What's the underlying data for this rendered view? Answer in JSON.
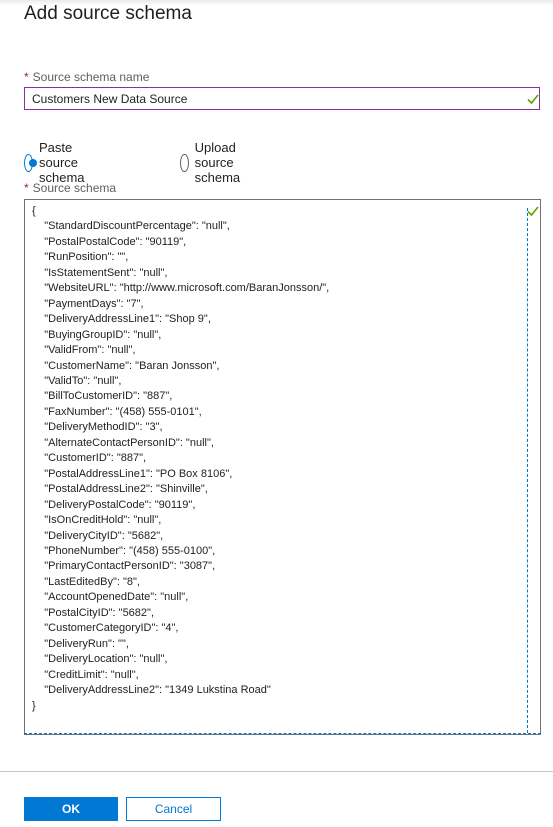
{
  "panel": {
    "title": "Add source schema"
  },
  "name_field": {
    "required_mark": "*",
    "label": "Source schema name",
    "value": "Customers New Data Source",
    "valid_icon": "checkmark-icon"
  },
  "schema_source": {
    "options": [
      {
        "label": "Paste source schema",
        "selected": true
      },
      {
        "label": "Upload source schema",
        "selected": false
      }
    ]
  },
  "schema_field": {
    "required_mark": "*",
    "label": "Source schema",
    "valid_icon": "checkmark-icon",
    "content": "{\n    \"StandardDiscountPercentage\": \"null\",\n    \"PostalPostalCode\": \"90119\",\n    \"RunPosition\": \"\",\n    \"IsStatementSent\": \"null\",\n    \"WebsiteURL\": \"http://www.microsoft.com/BaranJonsson/\",\n    \"PaymentDays\": \"7\",\n    \"DeliveryAddressLine1\": \"Shop 9\",\n    \"BuyingGroupID\": \"null\",\n    \"ValidFrom\": \"null\",\n    \"CustomerName\": \"Baran Jonsson\",\n    \"ValidTo\": \"null\",\n    \"BillToCustomerID\": \"887\",\n    \"FaxNumber\": \"(458) 555-0101\",\n    \"DeliveryMethodID\": \"3\",\n    \"AlternateContactPersonID\": \"null\",\n    \"CustomerID\": \"887\",\n    \"PostalAddressLine1\": \"PO Box 8106\",\n    \"PostalAddressLine2\": \"Shinville\",\n    \"DeliveryPostalCode\": \"90119\",\n    \"IsOnCreditHold\": \"null\",\n    \"DeliveryCityID\": \"5682\",\n    \"PhoneNumber\": \"(458) 555-0100\",\n    \"PrimaryContactPersonID\": \"3087\",\n    \"LastEditedBy\": \"8\",\n    \"AccountOpenedDate\": \"null\",\n    \"PostalCityID\": \"5682\",\n    \"CustomerCategoryID\": \"4\",\n    \"DeliveryRun\": \"\",\n    \"DeliveryLocation\": \"null\",\n    \"CreditLimit\": \"null\",\n    \"DeliveryAddressLine2\": \"1349 Lukstina Road\"\n}"
  },
  "footer": {
    "ok_label": "OK",
    "cancel_label": "Cancel"
  },
  "colors": {
    "accent": "#0078d4",
    "valid": "#57a300",
    "required": "#a4262c",
    "focus_border": "#8a2da5"
  }
}
